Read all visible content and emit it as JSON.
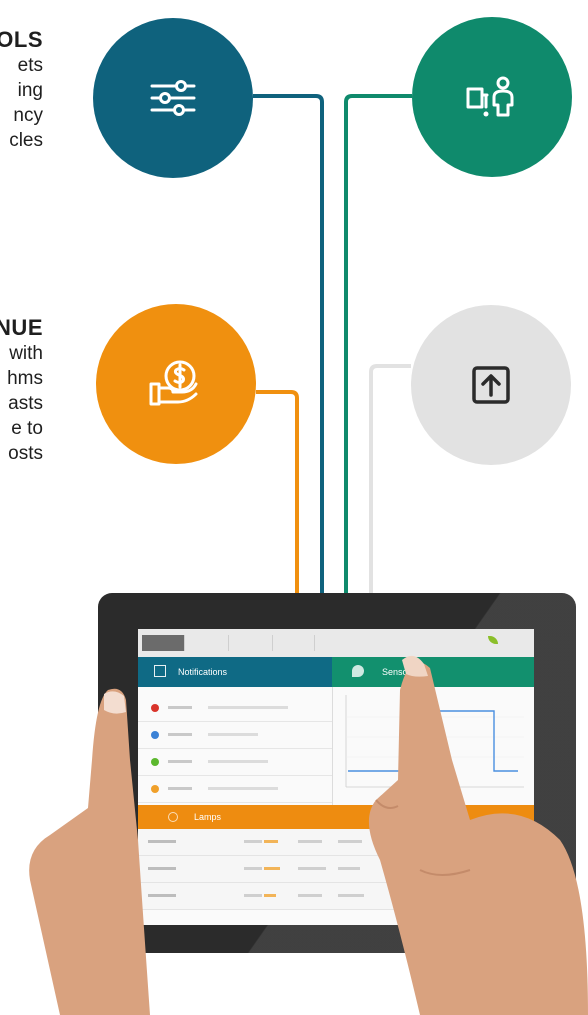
{
  "left_blocks": [
    {
      "heading": "OLS",
      "lines": [
        "ets",
        "ing",
        "ncy",
        "cles"
      ]
    },
    {
      "heading": "NUE",
      "lines": [
        "with",
        "hms",
        "asts",
        "e to",
        "osts"
      ]
    }
  ],
  "circles": [
    {
      "icon": "tune-sliders-icon",
      "color": "#0f627d"
    },
    {
      "icon": "device-person-icon",
      "color": "#0f8a6c"
    },
    {
      "icon": "money-hand-icon",
      "color": "#f0900f"
    },
    {
      "icon": "upload-box-icon",
      "color": "#e2e2e2"
    }
  ],
  "tablet": {
    "panels": {
      "notifications": "Notifications",
      "sensors": "Sensors",
      "lamps": "Lamps"
    },
    "accent_colors": {
      "notifications": "#0f6a85",
      "sensors": "#12906e",
      "lamps": "#ee8c10"
    },
    "notification_dots": [
      "#d9342b",
      "#3b82d6",
      "#5cb82e",
      "#f0a02a"
    ]
  }
}
